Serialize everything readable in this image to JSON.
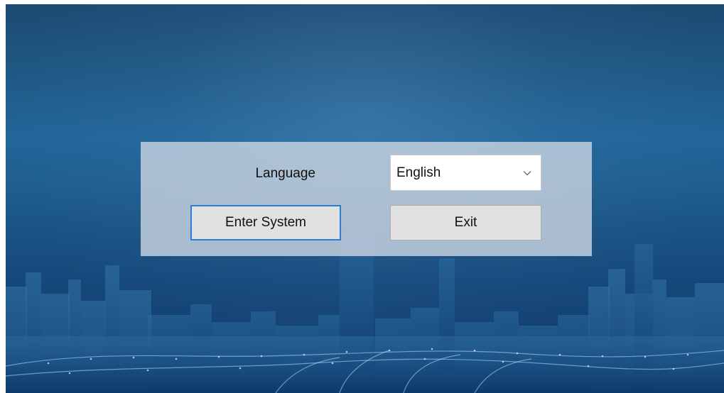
{
  "login_panel": {
    "language_label": "Language",
    "language_select": {
      "selected": "English"
    },
    "enter_button_label": "Enter System",
    "exit_button_label": "Exit"
  },
  "icons": {
    "dropdown": "chevron-down-icon"
  },
  "colors": {
    "background_top": "#1c4a72",
    "background_bottom": "#0e3564",
    "focus_border": "#2a7fd4",
    "button_face": "#e1e1e1"
  }
}
